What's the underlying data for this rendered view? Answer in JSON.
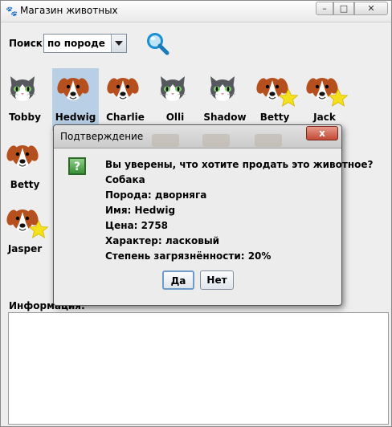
{
  "window": {
    "title": "Магазин животных",
    "minimize": "–",
    "maximize": "□",
    "close": "✕"
  },
  "search": {
    "label": "Поиск:",
    "value": "по породе"
  },
  "animals": [
    {
      "name": "Tobby",
      "kind": "cat",
      "star": false
    },
    {
      "name": "Hedwig",
      "kind": "dog",
      "star": false,
      "selected": true
    },
    {
      "name": "Charlie",
      "kind": "dog",
      "star": false
    },
    {
      "name": "Olli",
      "kind": "cat",
      "star": false
    },
    {
      "name": "Shadow",
      "kind": "cat",
      "star": false
    },
    {
      "name": "Betty",
      "kind": "dog",
      "star": true
    },
    {
      "name": "Jack",
      "kind": "dog",
      "star": true
    },
    {
      "name": "Betty",
      "kind": "dog",
      "star": false
    },
    {
      "name": "Jasper",
      "kind": "dog",
      "star": true
    }
  ],
  "info": {
    "label": "Информация:"
  },
  "dialog": {
    "title": "Подтверждение",
    "close": "x",
    "icon_symbol": "?",
    "lines": [
      "Вы уверены, что хотите продать это животное?",
      "Собака",
      "Порода: дворняга",
      "Имя: Hedwig",
      "Цена: 2758",
      "Характер: ласковый",
      "Степень загрязнённости: 20%"
    ],
    "yes": "Да",
    "no": "Нет"
  },
  "colors": {
    "dog_fur": "#b5501e",
    "cat_fur": "#55585c",
    "star": "#f5e11b",
    "selection": "#b8cfe5"
  }
}
